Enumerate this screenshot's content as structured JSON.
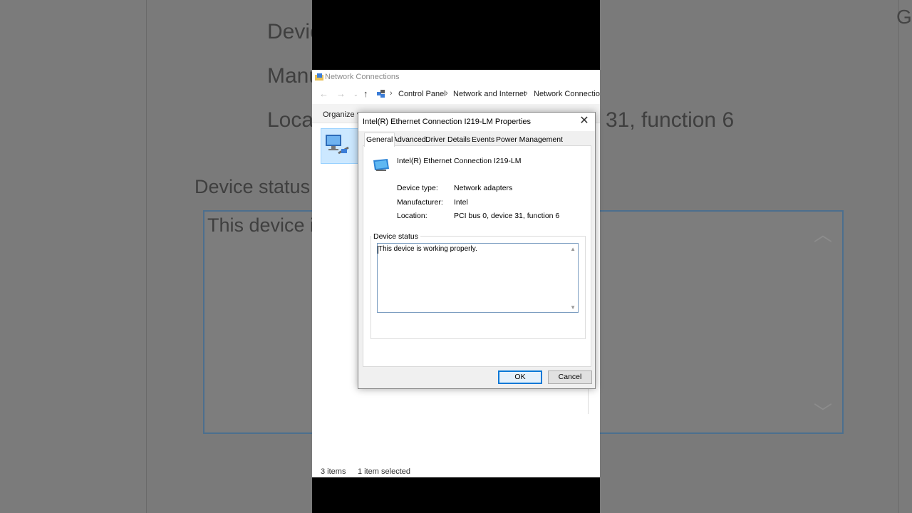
{
  "background": {
    "text_lines": [
      "Devic",
      "Manu",
      "Loca",
      "31, function 6",
      "Device status",
      "This device i"
    ],
    "right_glyph": "G"
  },
  "explorer": {
    "title": "Network Connections",
    "breadcrumbs": [
      "Control Panel",
      "Network and Internet",
      "Network Connections"
    ],
    "organize_label": "Organize ▾",
    "status_items": "3 items",
    "status_selected": "1 item selected"
  },
  "dialog": {
    "title": "Intel(R) Ethernet Connection I219-LM Properties",
    "tabs": [
      "General",
      "Advanced",
      "Driver",
      "Details",
      "Events",
      "Power Management"
    ],
    "active_tab": "General",
    "device_name": "Intel(R) Ethernet Connection I219-LM",
    "properties": [
      {
        "label": "Device type:",
        "value": "Network adapters"
      },
      {
        "label": "Manufacturer:",
        "value": "Intel"
      },
      {
        "label": "Location:",
        "value": "PCI bus 0, device 31, function 6"
      }
    ],
    "status_group_label": "Device status",
    "status_text": "This device is working properly.",
    "ok_label": "OK",
    "cancel_label": "Cancel"
  },
  "colors": {
    "accent": "#0078d7",
    "selection": "#cce8ff"
  }
}
